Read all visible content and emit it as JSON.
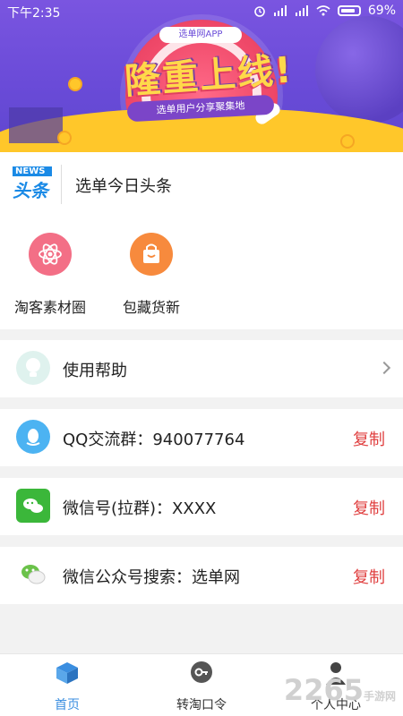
{
  "status_bar": {
    "time": "下午2:35",
    "battery": "69%"
  },
  "banner": {
    "app_chip": "选单网APP",
    "headline": "隆重上线!",
    "subtitle": "选单用户分享聚集地"
  },
  "news": {
    "logo_top": "NEWS",
    "logo_bottom": "头条",
    "text": "选单今日头条"
  },
  "shortcuts": [
    {
      "label": "淘客素材圈",
      "icon": "atom-icon",
      "color": "#f36f86"
    },
    {
      "label": "包藏货新",
      "icon": "shopping-bag-icon",
      "color": "#f78a3d"
    }
  ],
  "rows": [
    {
      "icon": "lightbulb-icon",
      "text": "使用帮助",
      "action": ""
    },
    {
      "icon": "qq-icon",
      "text": "QQ交流群：940077764",
      "action": "复制"
    },
    {
      "icon": "wechat-icon",
      "text": "微信号(拉群)：XXXX",
      "action": "复制"
    },
    {
      "icon": "wechat-official-icon",
      "text": "微信公众号搜索：选单网",
      "action": "复制"
    }
  ],
  "bottom_nav": [
    {
      "label": "首页",
      "icon": "home-box-icon",
      "active": true
    },
    {
      "label": "转淘口令",
      "icon": "key-bubble-icon",
      "active": false
    },
    {
      "label": "个人中心",
      "icon": "user-icon",
      "active": false
    }
  ],
  "watermark": {
    "big": "2265",
    "small": "手游网"
  },
  "colors": {
    "accent": "#3a8ee0",
    "copy": "#e04040",
    "banner": "#6a4bd8"
  }
}
